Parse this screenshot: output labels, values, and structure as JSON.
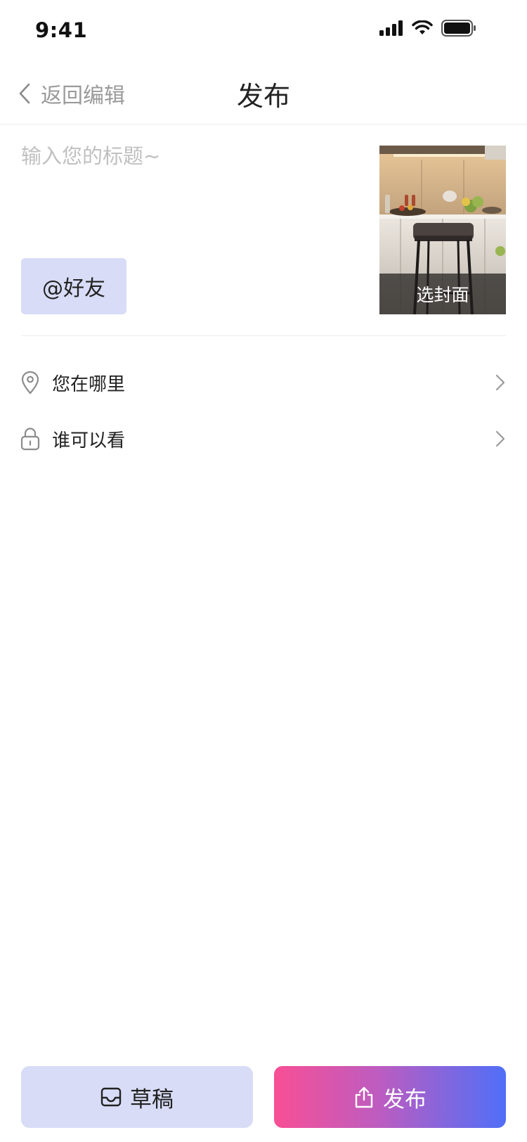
{
  "status_bar": {
    "time": "9:41"
  },
  "nav": {
    "back_label": "返回编辑",
    "title": "发布"
  },
  "title_field": {
    "value": "",
    "placeholder": "输入您的标题~"
  },
  "mention_button": {
    "label": "@好友"
  },
  "cover": {
    "label": "选封面"
  },
  "rows": [
    {
      "label": "您在哪里",
      "icon": "location-pin-icon"
    },
    {
      "label": "谁可以看",
      "icon": "lock-icon"
    }
  ],
  "actions": {
    "draft_label": "草稿",
    "publish_label": "发布"
  },
  "colors": {
    "accent_light": "#d8dcf6",
    "publish_gradient_start": "#f84f95",
    "publish_gradient_end": "#4f6ff8",
    "placeholder": "#c0c0c0",
    "secondary_text": "#9a9a9a"
  }
}
